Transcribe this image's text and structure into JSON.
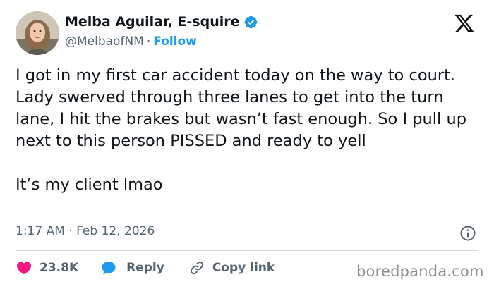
{
  "header": {
    "display_name": "Melba Aguilar, E-squire",
    "handle": "@MelbaofNM",
    "separator": "·",
    "follow_label": "Follow",
    "avatar_icon": "profile-photo",
    "verified_icon": "verified-badge-icon",
    "platform_icon": "x-logo-icon"
  },
  "tweet": {
    "text": "I got in my first car accident today on the way to court. Lady swerved through three lanes to get into the turn lane, I hit the brakes but wasn’t fast enough. So I pull up next to this person PISSED and ready to yell\n\nIt’s my client lmao",
    "timestamp": "1:17 AM · Feb 12, 2026"
  },
  "actions": {
    "like_count": "23.8K",
    "reply_label": "Reply",
    "copy_link_label": "Copy link"
  },
  "watermark": "boredpanda.com",
  "colors": {
    "text_primary": "#0f1419",
    "text_secondary": "#536471",
    "accent_blue": "#1d9bf0",
    "like_pink": "#f91880",
    "divider": "#cfd9de"
  }
}
